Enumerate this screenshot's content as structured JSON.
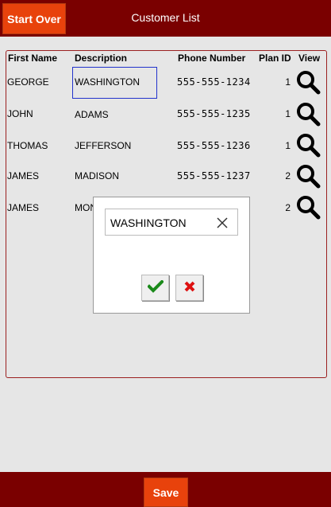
{
  "header": {
    "start_over_label": "Start Over",
    "title": "Customer List"
  },
  "table": {
    "columns": [
      "First Name",
      "Description",
      "Phone Number",
      "Plan ID",
      "View"
    ],
    "rows": [
      {
        "first_name": "GEORGE",
        "description": "WASHINGTON",
        "phone": "555-555-1234",
        "plan_id": "1",
        "view_icon": "search-icon"
      },
      {
        "first_name": "JOHN",
        "description": "ADAMS",
        "phone": "555-555-1235",
        "plan_id": "1",
        "view_icon": "search-icon"
      },
      {
        "first_name": "THOMAS",
        "description": "JEFFERSON",
        "phone": "555-555-1236",
        "plan_id": "1",
        "view_icon": "search-icon"
      },
      {
        "first_name": "JAMES",
        "description": "MADISON",
        "phone": "555-555-1237",
        "plan_id": "2",
        "view_icon": "search-icon"
      },
      {
        "first_name": "JAMES",
        "description": "MON",
        "phone": "",
        "plan_id": "2",
        "view_icon": "search-icon"
      }
    ]
  },
  "edit_dialog": {
    "value": "WASHINGTON",
    "clear_icon": "close-icon",
    "confirm_icon": "checkmark-icon",
    "cancel_icon": "x-icon"
  },
  "footer": {
    "save_label": "Save"
  },
  "colors": {
    "header_bg": "#7a0000",
    "button_orange": "#e8420c",
    "confirm_green": "#1a8a1a",
    "cancel_red": "#dd1111",
    "selection_border": "#2233cc"
  }
}
